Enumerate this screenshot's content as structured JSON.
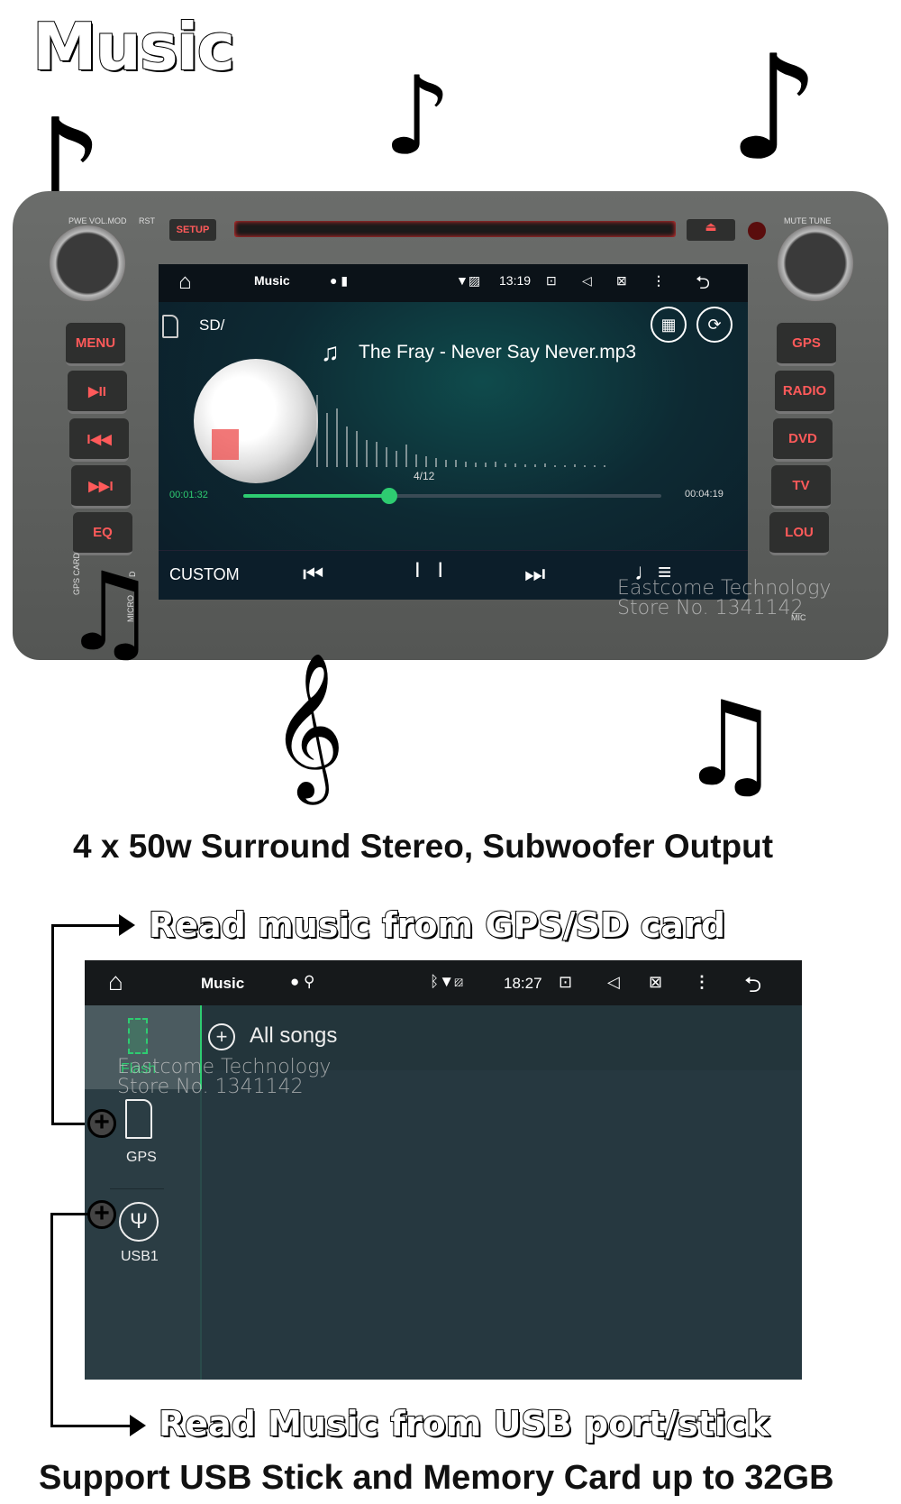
{
  "title": "Music",
  "device": {
    "labels": {
      "power": "PWE VOL.MOD",
      "reset": "RST",
      "setup": "SETUP",
      "mute": "MUTE TUNE",
      "gps_card": "GPS CARD",
      "micro": "MICRO",
      "sd": "D",
      "mic": "MIC"
    },
    "left_buttons": [
      "MENU",
      "▶II",
      "I◀◀",
      "▶▶I",
      "EQ"
    ],
    "right_buttons": [
      "GPS",
      "RADIO",
      "DVD",
      "TV",
      "LOU"
    ],
    "accent": "#ff4d4d"
  },
  "player": {
    "status": {
      "app": "Music",
      "time": "13:19"
    },
    "path": "SD/",
    "song": "The Fray - Never Say Never.mp3",
    "track_index": "4/12",
    "elapsed": "00:01:32",
    "duration": "00:04:19",
    "progress_percent": 35,
    "eq_mode": "CUSTOM",
    "accent": "#2ecc71"
  },
  "watermark": {
    "line1": "Eastcome Technology",
    "line2": "Store No. 1341142"
  },
  "headline": "4 x 50w Surround Stereo, Subwoofer Output",
  "callout_sd": "Read music from GPS/SD card",
  "browser": {
    "status": {
      "app": "Music",
      "time": "18:27"
    },
    "sources": [
      {
        "label": "Flash",
        "icon": "chip-icon"
      },
      {
        "label": "GPS",
        "icon": "sd-card-icon"
      },
      {
        "label": "USB1",
        "icon": "usb-icon"
      }
    ],
    "list": [
      {
        "label": "All songs"
      }
    ]
  },
  "callout_usb": "Read Music from USB port/stick",
  "footer": "Support USB Stick and Memory Card up to 32GB"
}
